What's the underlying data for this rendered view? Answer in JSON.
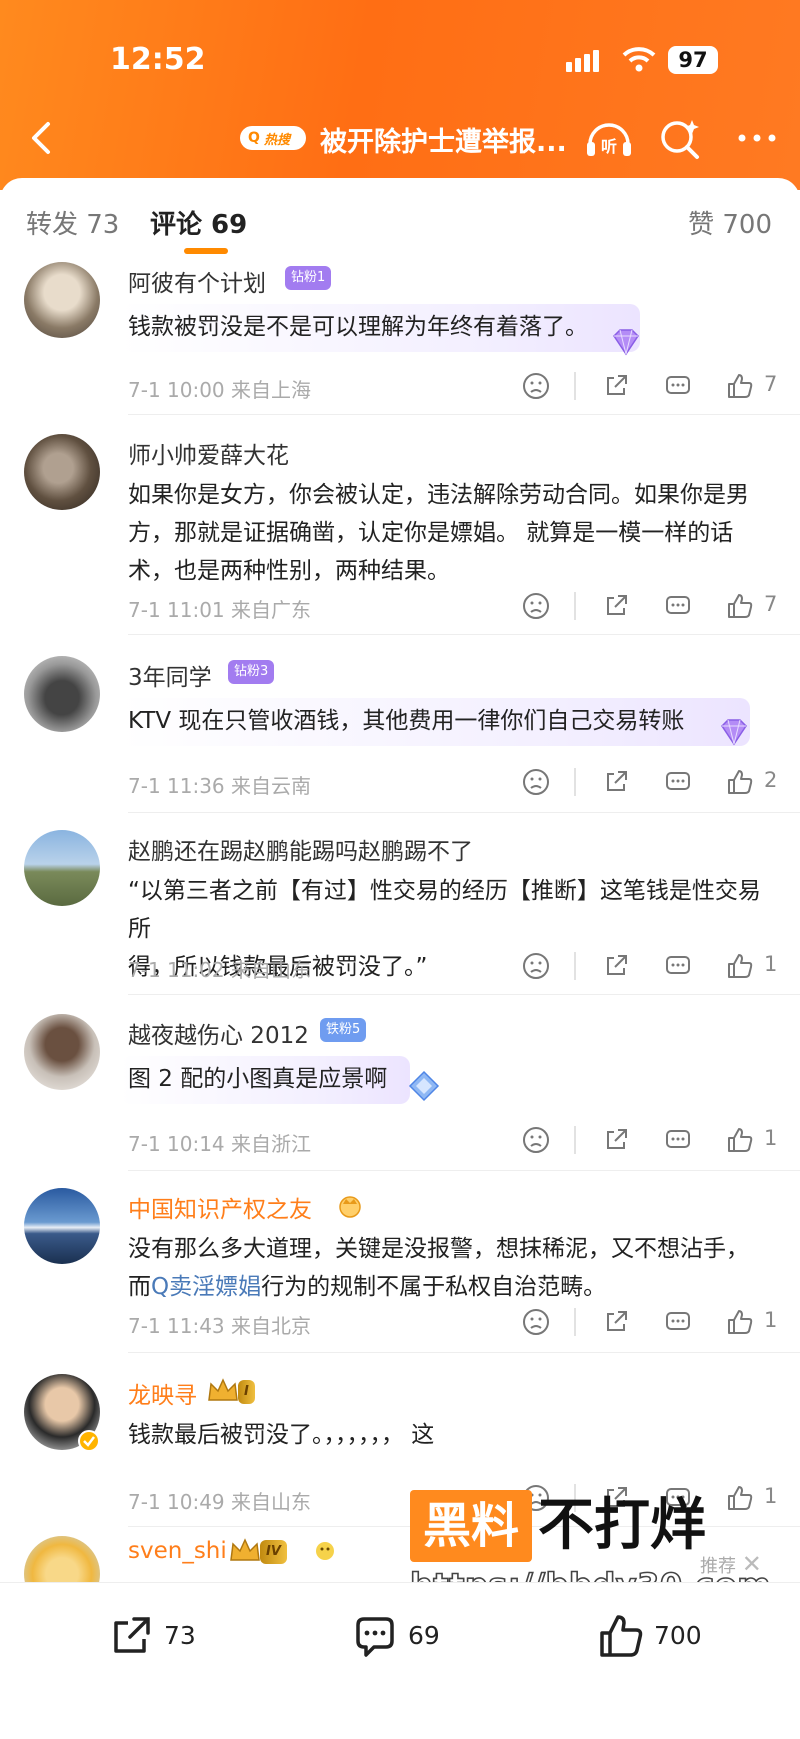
{
  "status_bar": {
    "time": "12:52",
    "battery": "97"
  },
  "nav": {
    "hot_tag": "热搜",
    "title": "被开除护士遭举报..."
  },
  "tabs": {
    "forward": "转发 73",
    "comments": "评论 69",
    "likes": "赞 700"
  },
  "comments": [
    {
      "name": "阿彼有个计划",
      "badge": "钻粉1",
      "lines": [
        "钱款被罚没是不是可以理解为年终有着落了。"
      ],
      "time": "7-1 10:00",
      "location": "来自上海",
      "likes": "7"
    },
    {
      "name": "师小帅爱薛大花",
      "badge": "",
      "lines": [
        "如果你是女方，你会被认定，违法解除劳动合同。如果你是男",
        "方，那就是证据确凿，认定你是嫖娼。 就算是一模一样的话",
        "术，也是两种性别，两种结果。"
      ],
      "time": "7-1 11:01",
      "location": "来自广东",
      "likes": "7"
    },
    {
      "name": "3年同学",
      "badge": "钻粉3",
      "lines": [
        "KTV 现在只管收酒钱，其他费用一律你们自己交易转账"
      ],
      "time": "7-1 11:36",
      "location": "来自云南",
      "likes": "2"
    },
    {
      "name": "赵鹏还在踢赵鹏能踢吗赵鹏踢不了",
      "badge": "",
      "lines": [
        "“以第三者之前【有过】性交易的经历【推断】这笔钱是性交易所",
        "得，所以钱款最后被罚没了。”"
      ],
      "time": "7-1 11:02",
      "location": "来自山东",
      "likes": "1"
    },
    {
      "name": "越夜越伤心 2012",
      "badge": "铁粉5",
      "lines": [
        "图 2 配的小图真是应景啊"
      ],
      "time": "7-1 10:14",
      "location": "来自浙江",
      "likes": "1"
    },
    {
      "name": "中国知识产权之友",
      "badge": "",
      "lines": [
        "没有那么多大道理，关键是没报警，想抹稀泥，又不想沾手，"
      ],
      "line2_prefix": "而",
      "line2_link": "卖淫嫖娼",
      "line2_suffix": "行为的规制不属于私权自治范畴。",
      "time": "7-1 11:43",
      "location": "来自北京",
      "likes": "1"
    },
    {
      "name": "龙映寻",
      "badge": "I",
      "lines": [
        "钱款最后被罚没了。，，，，，，  这"
      ],
      "time": "7-1 10:49",
      "location": "来自山东",
      "likes": "1"
    },
    {
      "name": "sven_shi",
      "badge": "IV"
    }
  ],
  "overlay": {
    "recommend": "推荐"
  },
  "watermark": {
    "box": "黑料",
    "text": "不打烊",
    "url": "https://bbdy30.com"
  },
  "bottom_bar": {
    "forward": "73",
    "comments": "69",
    "likes": "700"
  },
  "colors": {
    "brand_orange": "#ff7e1a",
    "link_blue": "#4a7ab8",
    "purple_badge": "#a27cf0",
    "blue_badge": "#6f9cf0"
  }
}
